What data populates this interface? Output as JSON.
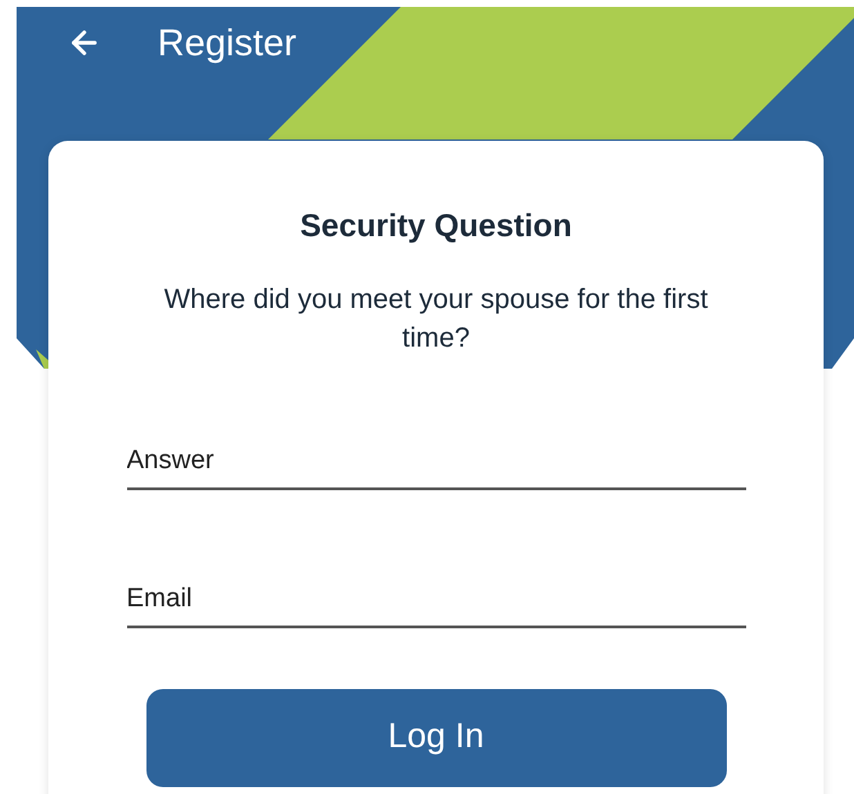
{
  "header": {
    "title": "Register"
  },
  "card": {
    "title": "Security Question",
    "question": "Where did you meet your spouse for the first time?",
    "fields": [
      {
        "placeholder": "Answer"
      },
      {
        "placeholder": "Email"
      }
    ],
    "button": "Log In"
  }
}
